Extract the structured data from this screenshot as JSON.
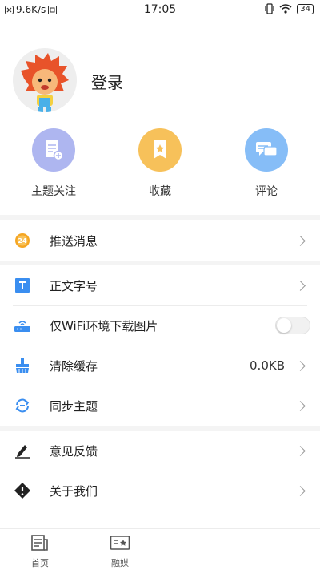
{
  "status_bar": {
    "speed": "9.6K/s",
    "time": "17:05",
    "battery": "34"
  },
  "profile": {
    "login_label": "登录"
  },
  "quick_actions": [
    {
      "label": "主题关注",
      "color": "#aeb6f0",
      "icon": "topic-follow-icon"
    },
    {
      "label": "收藏",
      "color": "#f7c15a",
      "icon": "bookmark-icon"
    },
    {
      "label": "评论",
      "color": "#86bdf7",
      "icon": "comment-icon"
    }
  ],
  "menu": {
    "push": {
      "label": "推送消息",
      "badge": "24"
    },
    "font": {
      "label": "正文字号"
    },
    "wifi": {
      "label": "仅WiFi环境下载图片",
      "enabled": false
    },
    "cache": {
      "label": "清除缓存",
      "value": "0.0KB"
    },
    "sync": {
      "label": "同步主题"
    },
    "feedback": {
      "label": "意见反馈"
    },
    "about": {
      "label": "关于我们"
    }
  },
  "tabs": [
    {
      "label": "首页",
      "icon": "news-icon"
    },
    {
      "label": "融媒",
      "icon": "media-icon"
    }
  ],
  "colors": {
    "accent_blue": "#3a8ef0",
    "badge_orange": "#f5a623"
  }
}
